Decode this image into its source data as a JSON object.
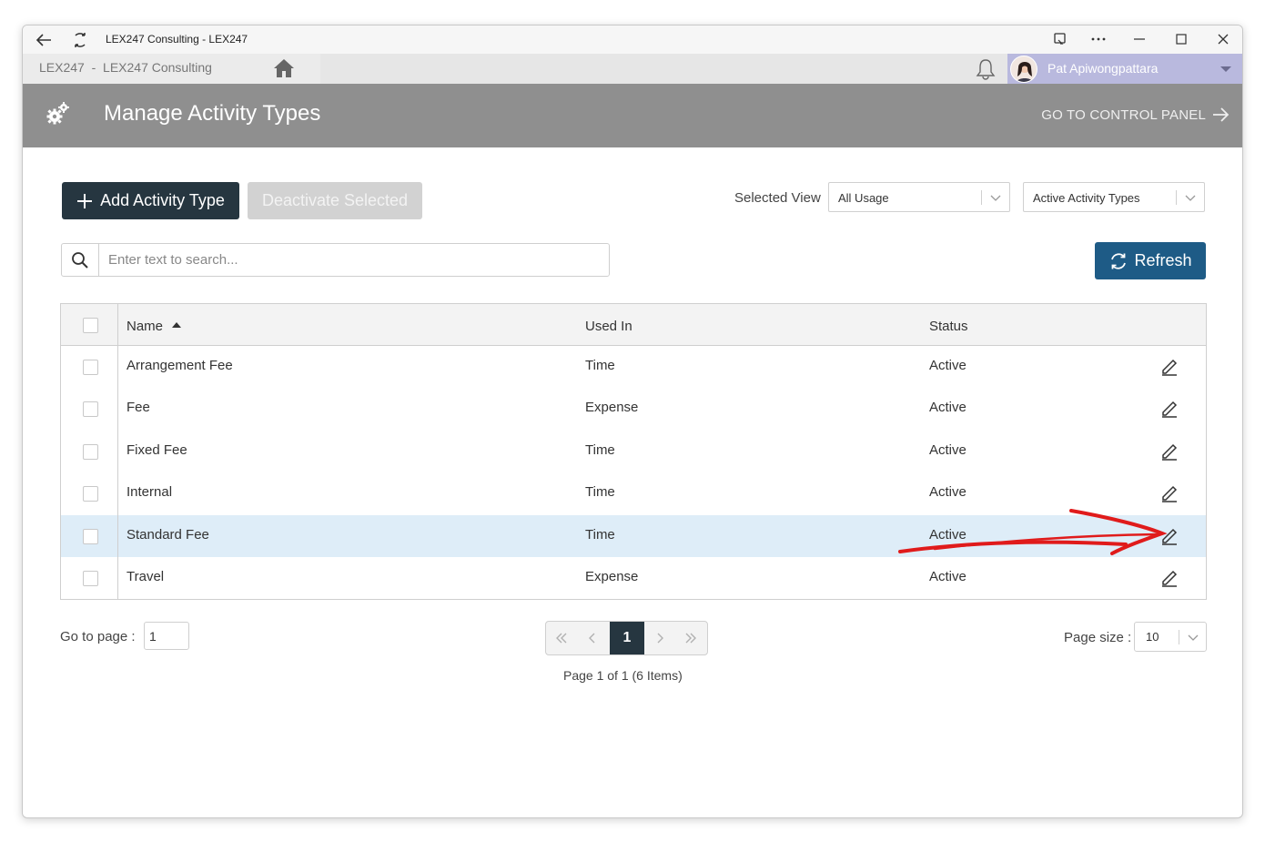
{
  "window": {
    "title": "LEX247 Consulting - LEX247"
  },
  "appbar": {
    "org": "LEX247  -  LEX247 Consulting",
    "user_name": "Pat Apiwongpattara"
  },
  "header": {
    "title": "Manage Activity Types",
    "go_link": "GO TO CONTROL PANEL"
  },
  "toolbar": {
    "add_label": "Add Activity Type",
    "deactivate_label": "Deactivate Selected",
    "selected_view_label": "Selected View",
    "usage_filter": "All Usage",
    "status_filter": "Active Activity Types",
    "refresh_label": "Refresh"
  },
  "search": {
    "placeholder": "Enter text to search..."
  },
  "table": {
    "columns": [
      "Name",
      "Used In",
      "Status"
    ],
    "rows": [
      {
        "name": "Arrangement Fee",
        "used_in": "Time",
        "status": "Active"
      },
      {
        "name": "Fee",
        "used_in": "Expense",
        "status": "Active"
      },
      {
        "name": "Fixed Fee",
        "used_in": "Time",
        "status": "Active"
      },
      {
        "name": "Internal",
        "used_in": "Time",
        "status": "Active"
      },
      {
        "name": "Standard Fee",
        "used_in": "Time",
        "status": "Active"
      },
      {
        "name": "Travel",
        "used_in": "Expense",
        "status": "Active"
      }
    ],
    "highlighted_row": 4
  },
  "pager": {
    "goto_label": "Go to page :",
    "goto_value": "1",
    "current_page": "1",
    "page_info": "Page 1 of 1 (6 Items)",
    "page_size_label": "Page size :",
    "page_size": "10"
  },
  "colors": {
    "header_bg": "#8f8f8f",
    "primary_dark": "#263640",
    "refresh_blue": "#1e5b86",
    "highlight_row": "#deedf8",
    "annotation_red": "#e01b1b"
  }
}
